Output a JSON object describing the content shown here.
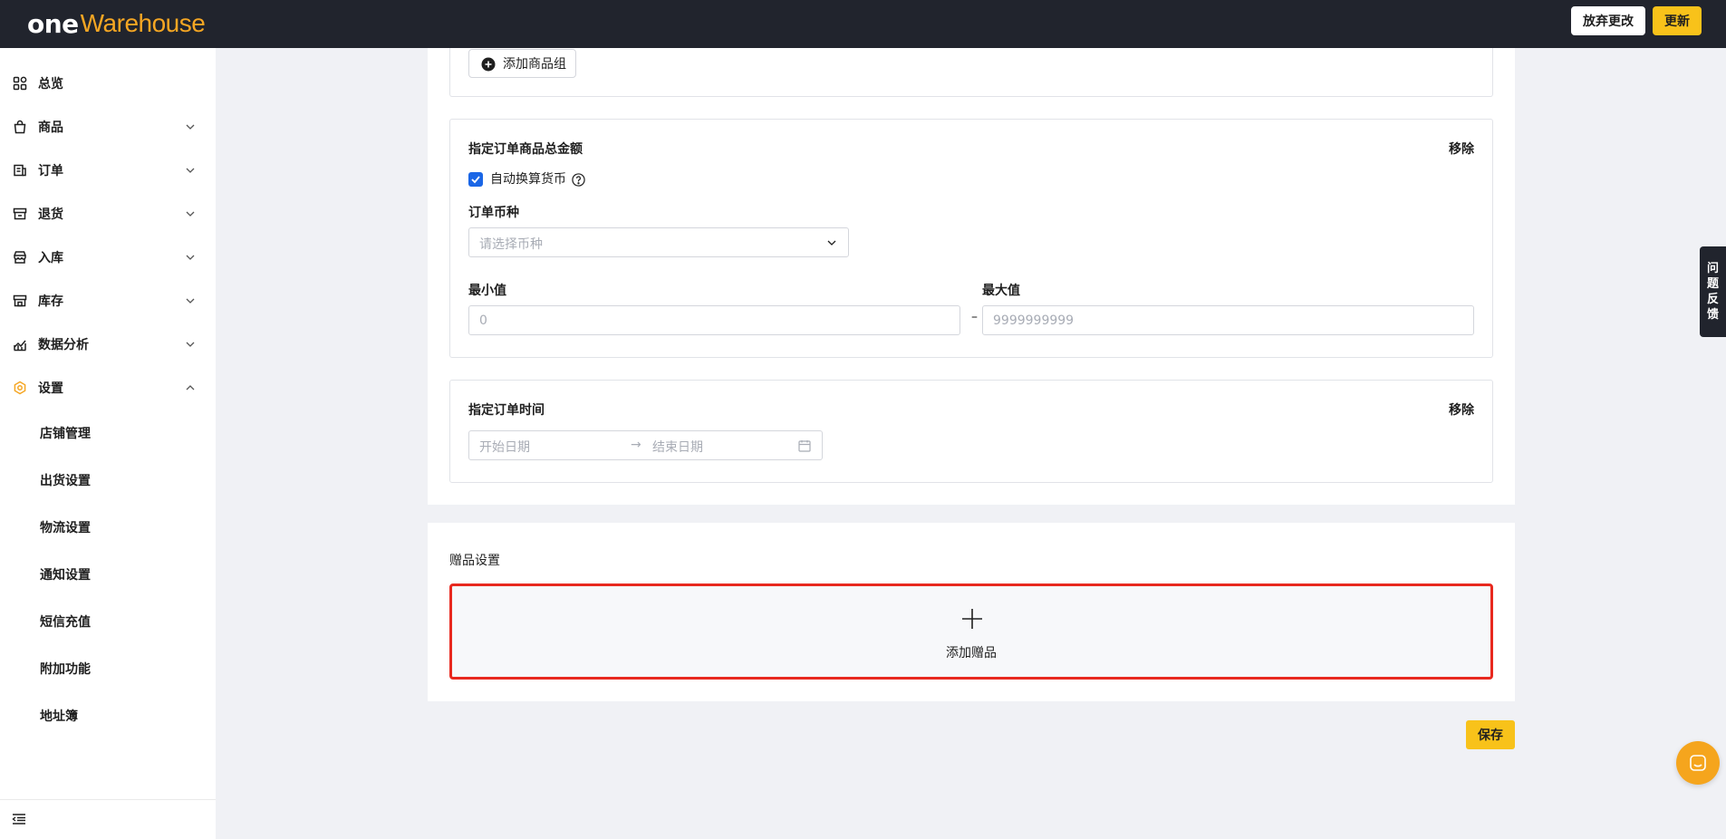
{
  "header": {
    "logo_one": "one",
    "logo_warehouse": "Warehouse",
    "discard_label": "放弃更改",
    "update_label": "更新"
  },
  "sidebar": {
    "items": [
      {
        "label": "总览",
        "icon": "dashboard-icon"
      },
      {
        "label": "商品",
        "icon": "shopping-bag-icon"
      },
      {
        "label": "订单",
        "icon": "order-icon"
      },
      {
        "label": "退货",
        "icon": "return-icon"
      },
      {
        "label": "入库",
        "icon": "inbound-icon"
      },
      {
        "label": "库存",
        "icon": "inventory-icon"
      },
      {
        "label": "数据分析",
        "icon": "analytics-icon"
      },
      {
        "label": "设置",
        "icon": "settings-icon"
      }
    ],
    "settings_subitems": [
      "店铺管理",
      "出货设置",
      "物流设置",
      "通知设置",
      "短信充值",
      "附加功能",
      "地址簿"
    ],
    "accent_color": "#f5a623"
  },
  "conditions": {
    "add_group_label": "添加商品组",
    "amount": {
      "title": "指定订单商品总金额",
      "remove_label": "移除",
      "auto_convert_label": "自动换算货币",
      "auto_convert_checked": true,
      "currency_label": "订单币种",
      "currency_placeholder": "请选择币种",
      "min_label": "最小值",
      "min_placeholder": "0",
      "max_label": "最大值",
      "max_placeholder": "9999999999",
      "separator": "–"
    },
    "time": {
      "title": "指定订单时间",
      "remove_label": "移除",
      "start_placeholder": "开始日期",
      "end_placeholder": "结束日期",
      "arrow": "→"
    }
  },
  "gift": {
    "title": "赠品设置",
    "add_label": "添加赠品",
    "highlight_color": "#e8291f"
  },
  "footer": {
    "save_label": "保存"
  },
  "feedback": {
    "chars": [
      "问",
      "题",
      "反",
      "馈"
    ]
  },
  "colors": {
    "topbar": "#21242d",
    "primary_button": "#f8c21a",
    "checkbox": "#1a66e6"
  }
}
